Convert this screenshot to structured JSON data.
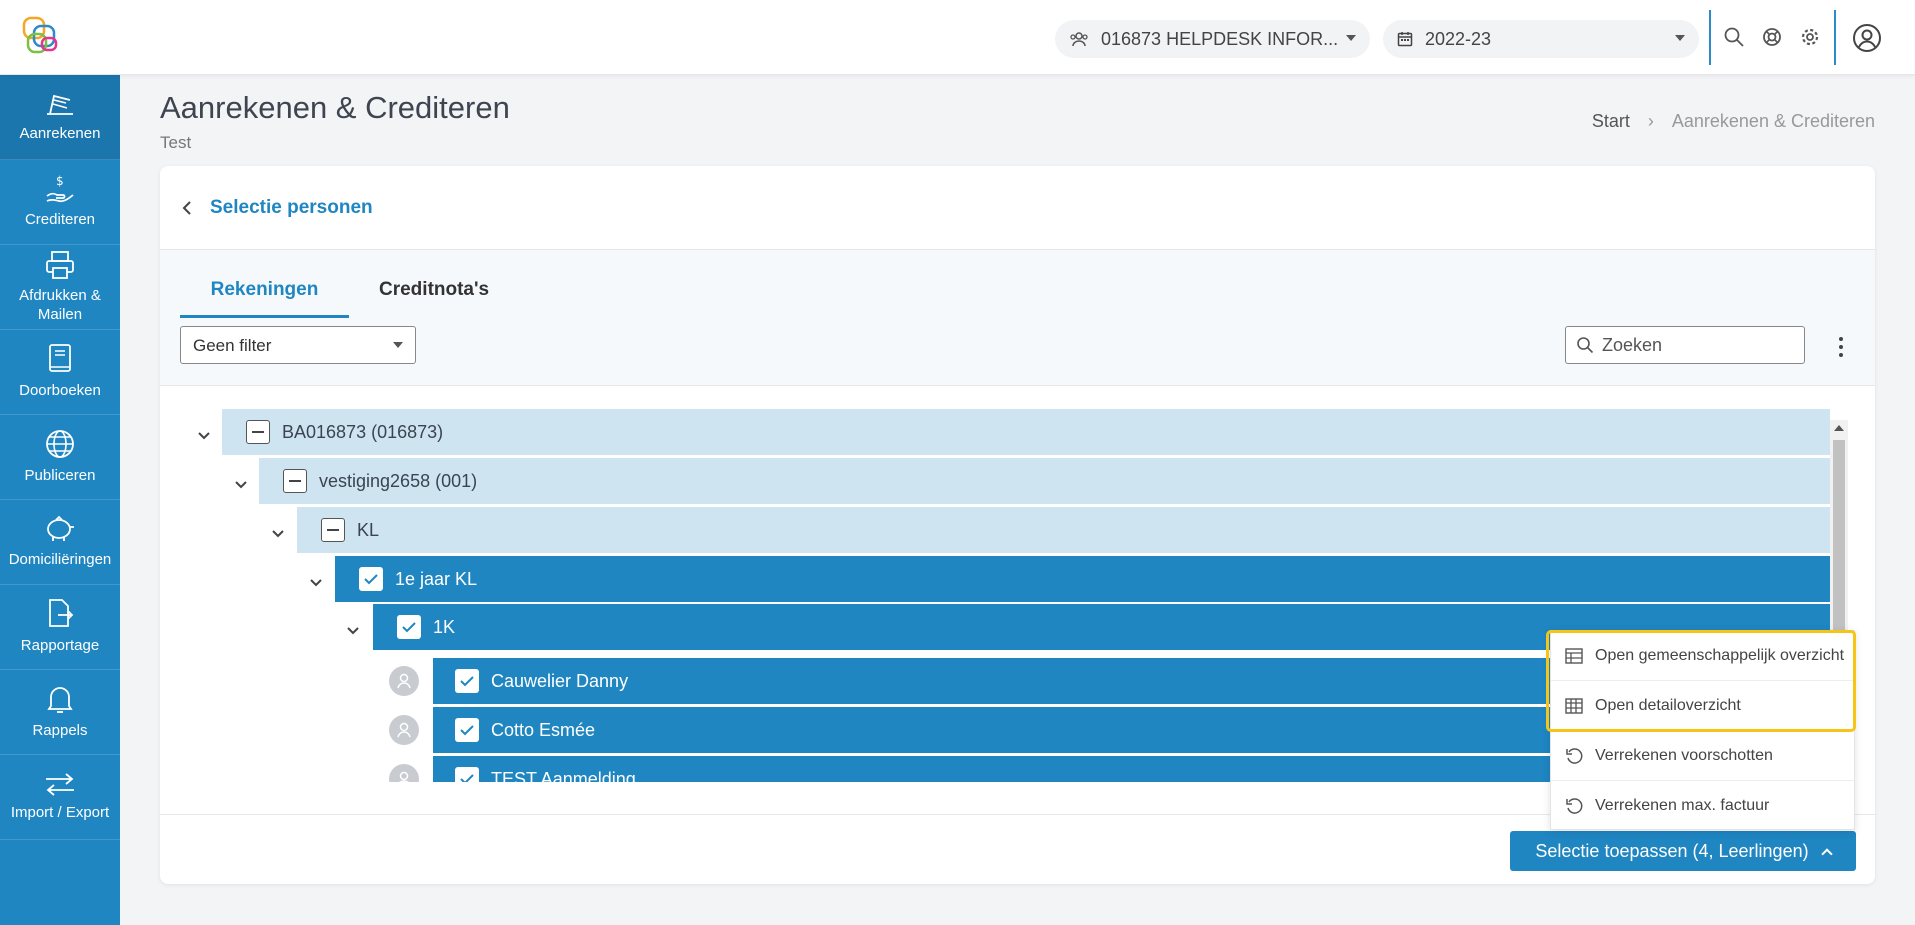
{
  "header": {
    "school_selector": "016873 HELPDESK INFOR...",
    "year_selector": "2022-23"
  },
  "sidebar": {
    "items": [
      {
        "label": "Aanrekenen",
        "icon": "invoice-icon"
      },
      {
        "label": "Crediteren",
        "icon": "hand-dollar-icon"
      },
      {
        "label": "Afdrukken & Mailen",
        "icon": "printer-icon"
      },
      {
        "label": "Doorboeken",
        "icon": "book-icon"
      },
      {
        "label": "Publiceren",
        "icon": "globe-icon"
      },
      {
        "label": "Domiciliëringen",
        "icon": "piggy-bank-icon"
      },
      {
        "label": "Rapportage",
        "icon": "file-export-icon"
      },
      {
        "label": "Rappels",
        "icon": "bell-icon"
      },
      {
        "label": "Import / Export",
        "icon": "swap-arrows-icon"
      }
    ]
  },
  "page": {
    "title": "Aanrekenen & Crediteren",
    "subtitle": "Test",
    "breadcrumb": {
      "start": "Start",
      "current": "Aanrekenen & Crediteren"
    }
  },
  "card": {
    "back_label": "Selectie personen",
    "tabs": [
      {
        "label": "Rekeningen"
      },
      {
        "label": "Creditnota's"
      }
    ],
    "filter_value": "Geen filter",
    "search_placeholder": "Zoeken",
    "tree": [
      {
        "label": "BA016873 (016873)",
        "level": 0,
        "state": "partial"
      },
      {
        "label": "vestiging2658 (001)",
        "level": 1,
        "state": "partial"
      },
      {
        "label": "KL",
        "level": 2,
        "state": "partial"
      },
      {
        "label": "1e jaar KL",
        "level": 3,
        "state": "checked"
      },
      {
        "label": "1K",
        "level": 4,
        "state": "checked"
      },
      {
        "label": "Cauwelier Danny",
        "level": 5,
        "state": "checked"
      },
      {
        "label": "Cotto Esmée",
        "level": 5,
        "state": "checked"
      },
      {
        "label": "TEST Aanmelding",
        "level": 5,
        "state": "checked"
      }
    ],
    "apply_button": "Selectie toepassen (4, Leerlingen)"
  },
  "menu": {
    "items": [
      {
        "label": "Open gemeenschappelijk overzicht",
        "icon": "table-icon"
      },
      {
        "label": "Open detailoverzicht",
        "icon": "grid-table-icon"
      },
      {
        "label": "Verrekenen voorschotten",
        "icon": "undo-icon"
      },
      {
        "label": "Verrekenen max. factuur",
        "icon": "undo-icon"
      }
    ]
  }
}
